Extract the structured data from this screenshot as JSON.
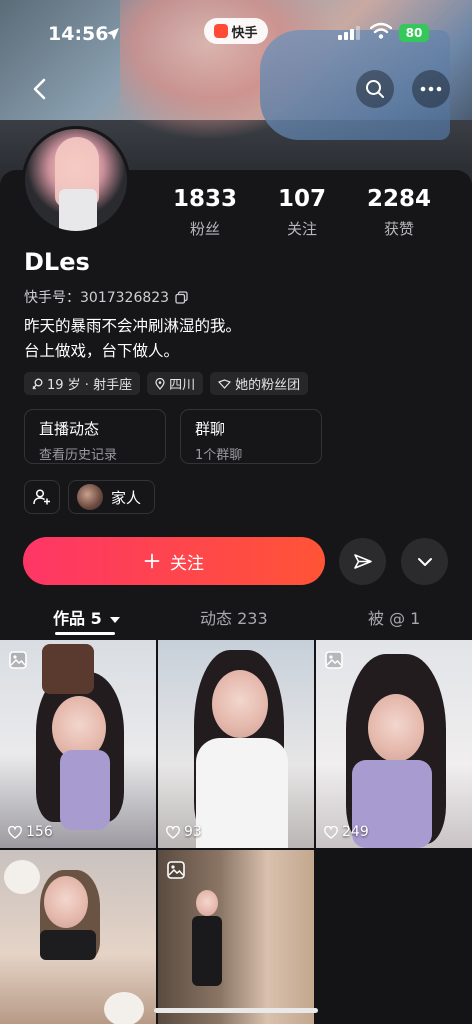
{
  "status_bar": {
    "time": "14:56",
    "app_name": "快手",
    "battery": "80"
  },
  "profile": {
    "stats": [
      {
        "value": "1833",
        "label": "粉丝"
      },
      {
        "value": "107",
        "label": "关注"
      },
      {
        "value": "2284",
        "label": "获赞"
      }
    ],
    "name": "DLes",
    "kuaishou_id": "快手号：3017326823",
    "bio_line1": "昨天的暴雨不会冲刷淋湿的我。",
    "bio_line2": "台上做戏，台下做人。",
    "tags": [
      "19 岁 · 射手座",
      "四川",
      "她的粉丝团"
    ],
    "cards": [
      {
        "title": "直播动态",
        "subtitle": "查看历史记录"
      },
      {
        "title": "群聊",
        "subtitle": "1个群聊"
      }
    ],
    "family_label": "家人",
    "follow_label": "关注"
  },
  "tabs": [
    {
      "label": "作品 5",
      "active": true
    },
    {
      "label": "动态 233",
      "active": false
    },
    {
      "label": "被 @ 1",
      "active": false
    }
  ],
  "posts": [
    {
      "likes": "156"
    },
    {
      "likes": "93"
    },
    {
      "likes": "249"
    },
    {
      "likes": ""
    },
    {
      "likes": ""
    }
  ],
  "colors": {
    "follow_start": "#fe3666",
    "follow_end": "#ff5436",
    "background": "#161618"
  }
}
